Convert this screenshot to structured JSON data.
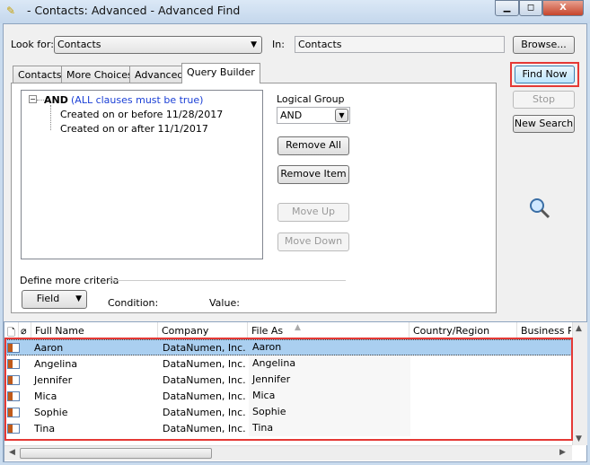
{
  "window": {
    "title": "- Contacts: Advanced - Advanced Find",
    "minimize": "▭",
    "maximize": "◻",
    "close": "X"
  },
  "lookfor": {
    "label": "Look for:",
    "value": "Contacts",
    "in_label": "In:",
    "in_value": "Contacts",
    "browse": "Browse..."
  },
  "tabs": [
    {
      "label": "Contacts"
    },
    {
      "label": "More Choices"
    },
    {
      "label": "Advanced"
    },
    {
      "label": "Query Builder",
      "active": true
    }
  ],
  "query": {
    "root": "AND",
    "root_desc": "(ALL clauses must be true)",
    "clauses": [
      "Created on or before 11/28/2017",
      "Created on or after 11/1/2017"
    ],
    "logical_group_label": "Logical Group",
    "logical_group_value": "AND",
    "remove_all": "Remove All",
    "remove_item": "Remove Item",
    "move_up": "Move Up",
    "move_down": "Move Down",
    "define_more": "Define more criteria",
    "field": "Field",
    "condition": "Condition:",
    "value": "Value:"
  },
  "actions": {
    "find_now": "Find Now",
    "stop": "Stop",
    "new_search": "New Search"
  },
  "results": {
    "columns": [
      "Full Name",
      "Company",
      "File As",
      "Country/Region",
      "Business Pl"
    ],
    "rows": [
      {
        "name": "Aaron",
        "company": "DataNumen, Inc.",
        "file_as": "Aaron"
      },
      {
        "name": "Angelina",
        "company": "DataNumen, Inc.",
        "file_as": "Angelina"
      },
      {
        "name": "Jennifer",
        "company": "DataNumen, Inc.",
        "file_as": "Jennifer"
      },
      {
        "name": "Mica",
        "company": "DataNumen, Inc.",
        "file_as": "Mica"
      },
      {
        "name": "Sophie",
        "company": "DataNumen, Inc.",
        "file_as": "Sophie"
      },
      {
        "name": "Tina",
        "company": "DataNumen, Inc.",
        "file_as": "Tina"
      }
    ]
  },
  "colors": {
    "highlight": "#e53935",
    "selection": "#aacff0"
  }
}
